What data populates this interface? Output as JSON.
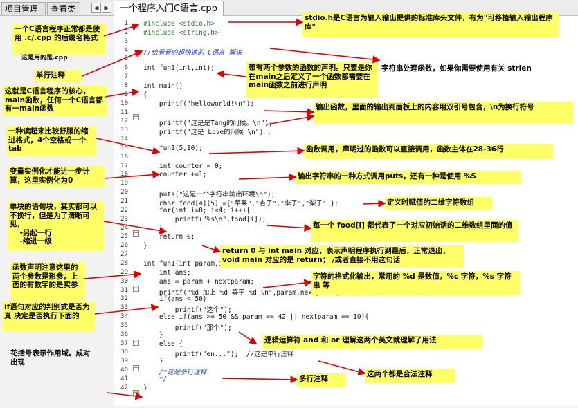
{
  "tabs": {
    "projects": "项目管理",
    "classview": "查看类",
    "nav_left": "◀",
    "nav_right": "▶",
    "file": "一个程序入门C语言.cpp"
  },
  "code_lines": [
    {
      "n": "1",
      "text": "#include <stdio.h>"
    },
    {
      "n": "2",
      "text": "#include <string.h>"
    },
    {
      "n": "3",
      "text": ""
    },
    {
      "n": "4",
      "text": "//给看看的超快速的 C语言 解说"
    },
    {
      "n": "5",
      "text": ""
    },
    {
      "n": "6",
      "text": "int fun1(int,int);"
    },
    {
      "n": "7",
      "text": ""
    },
    {
      "n": "8",
      "text": "int main()"
    },
    {
      "n": "9",
      "text": "{"
    },
    {
      "n": "10",
      "text": "    printf(\"helloworld!\\n\");"
    },
    {
      "n": "11",
      "text": ""
    },
    {
      "n": "12",
      "text": "    printf(\"这是是Tang的问候。\\n\");"
    },
    {
      "n": "13",
      "text": "    printf(\"这是 Love的问候 \\n\") ;"
    },
    {
      "n": "14",
      "text": ""
    },
    {
      "n": "15",
      "text": "    fun1(5,10);"
    },
    {
      "n": "16",
      "text": ""
    },
    {
      "n": "17",
      "text": "    int counter = 0;"
    },
    {
      "n": "18",
      "text": "    counter +=1;"
    },
    {
      "n": "19",
      "text": ""
    },
    {
      "n": "20",
      "text": "    puts(\"这是一个字符串输出环境\\n\");"
    },
    {
      "n": "21",
      "text": "    char food[4][5] ={\"苹果\",\"杏子\",\"李子\",\"梨子\" };"
    },
    {
      "n": "22",
      "text": "    for(int i=0; i<4; i++){"
    },
    {
      "n": "23",
      "text": "        printf(\"%s\\n\",food[i]);"
    },
    {
      "n": "24",
      "text": "    }"
    },
    {
      "n": "25",
      "text": "    return 0;"
    },
    {
      "n": "26",
      "text": "}"
    },
    {
      "n": "27",
      "text": ""
    },
    {
      "n": "28",
      "text": "int fun1(int param,int nextparam) {"
    },
    {
      "n": "29",
      "text": "    int ans;"
    },
    {
      "n": "30",
      "text": "    ans = param + nextparam;"
    },
    {
      "n": "31",
      "text": "    printf(\"%d 加上 %d 等于 %d \\n\",param,nextparam,ans);"
    },
    {
      "n": "32",
      "text": "    if(ans < 50)"
    },
    {
      "n": "33",
      "text": "        printf(\"这个\");"
    },
    {
      "n": "34",
      "text": "    else if(ans >= 50 && param == 42 || nextparam == 10){"
    },
    {
      "n": "35",
      "text": "        printf(\"那个\");"
    },
    {
      "n": "36",
      "text": "    }"
    },
    {
      "n": "37",
      "text": "    else {"
    },
    {
      "n": "38",
      "text": "        printf(\"en...\");  //这是单行注释"
    },
    {
      "n": "39",
      "text": "    }"
    },
    {
      "n": "40",
      "text": "    /*这是多行注释"
    },
    {
      "n": "41",
      "text": "    */"
    },
    {
      "n": "42",
      "text": "}"
    }
  ],
  "notes": {
    "cpp_suffix": "一个C语言程序正常都是使用 .c/.cpp 的后缀名格式",
    "cpp_suffix_cut": "这是用的是.cpp",
    "single_comment": "单行注释",
    "main_core": "这就是C语言程序的核心，main函数，任何一个C语言都有一main函数",
    "indent": "一种读起来比较舒服的缩进格式，4个空格或一个tab",
    "var_init": "变量实例化才能进一步计算，这里实例化为0",
    "block": "单块的语句块，其实都可以不换行，但是为了清晰可见，\n    -另起一行\n    -缩进一级",
    "decl_note": "函数声明注意这里的两个参数是形参，上面的有数字的是实参",
    "if_note": "if语句对应的判别式是否为真 决定是否执行下面的",
    "braces": "花括号表示作用域。成对出现",
    "stdio": "stdio.h是C语言为输入输出提供的标准库头文件，有为\"可移植输入输出程序库\"",
    "fun_decl": "带有两个参数的函数的声明。只要是你在main之后定义了一个函数都需要在main函数之前进行声明",
    "strlen": "字符串处理函数，如果你需要使用有关 strlen",
    "printf_note": "输出函数，里面的输出到面板上的内容用双引号包含，\\n为换行符号",
    "call_note": "函数调用，声明过的函数可以直接调用，函数主体在28-36行",
    "puts_note": "输出字符串的一种方式调用puts，还有一种是使用 %S",
    "array_note": "定义时赋值的二维字符数组",
    "food_note": "每一个 food[i] 都代表了一个对应初始话的二维数组里面的值",
    "return_note": "return 0 与 int main 对应，表示声明程序执行到最后，正常退出，void main 对应的是 return； /或者直接不用这句话",
    "format_note": "字符的格式化输出，常用的 %d 是数值，%c 字符，%s 字符串 等",
    "logic_note": "逻辑运算符 and 和 or 理解这两个英文就理解了用法",
    "multi_comment": "多行注释",
    "both_legal": "这两个都是合法注释"
  }
}
